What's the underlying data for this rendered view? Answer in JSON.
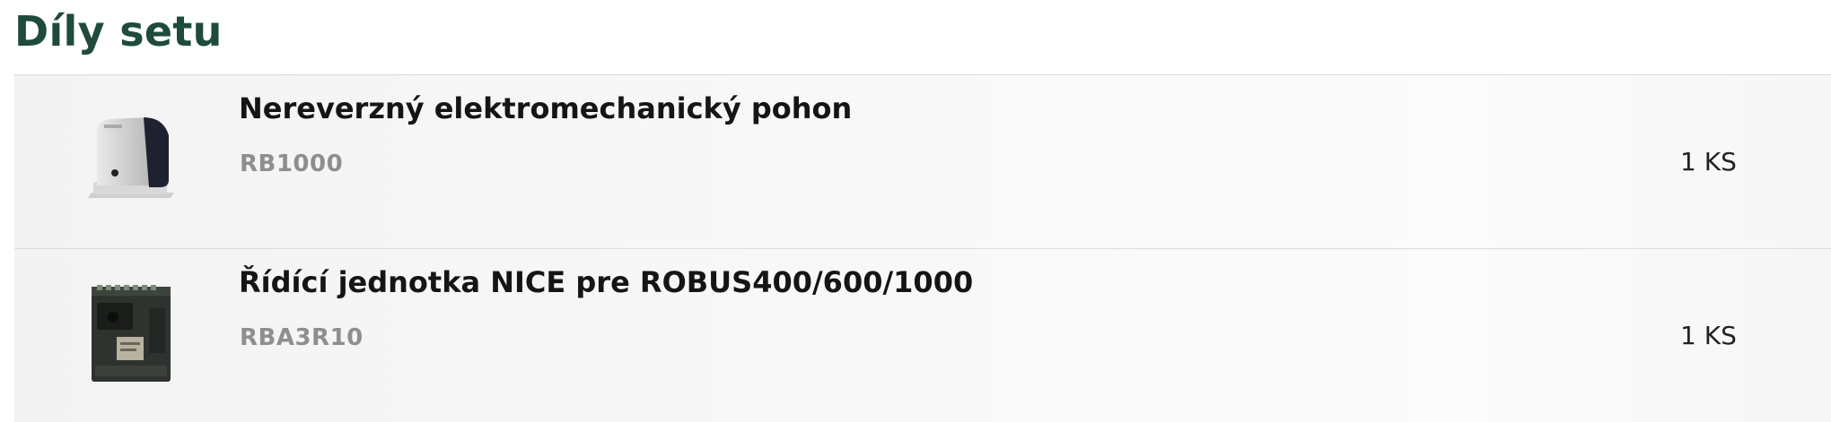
{
  "section": {
    "title": "Díly setu"
  },
  "items": [
    {
      "name": "Nereverzný elektromechanický pohon",
      "code": "RB1000",
      "quantity": "1 KS",
      "image_icon": "gate-motor-icon"
    },
    {
      "name": "Řídící jednotka NICE pre ROBUS400/600/1000",
      "code": "RBA3R10",
      "quantity": "1 KS",
      "image_icon": "control-board-icon"
    }
  ]
}
